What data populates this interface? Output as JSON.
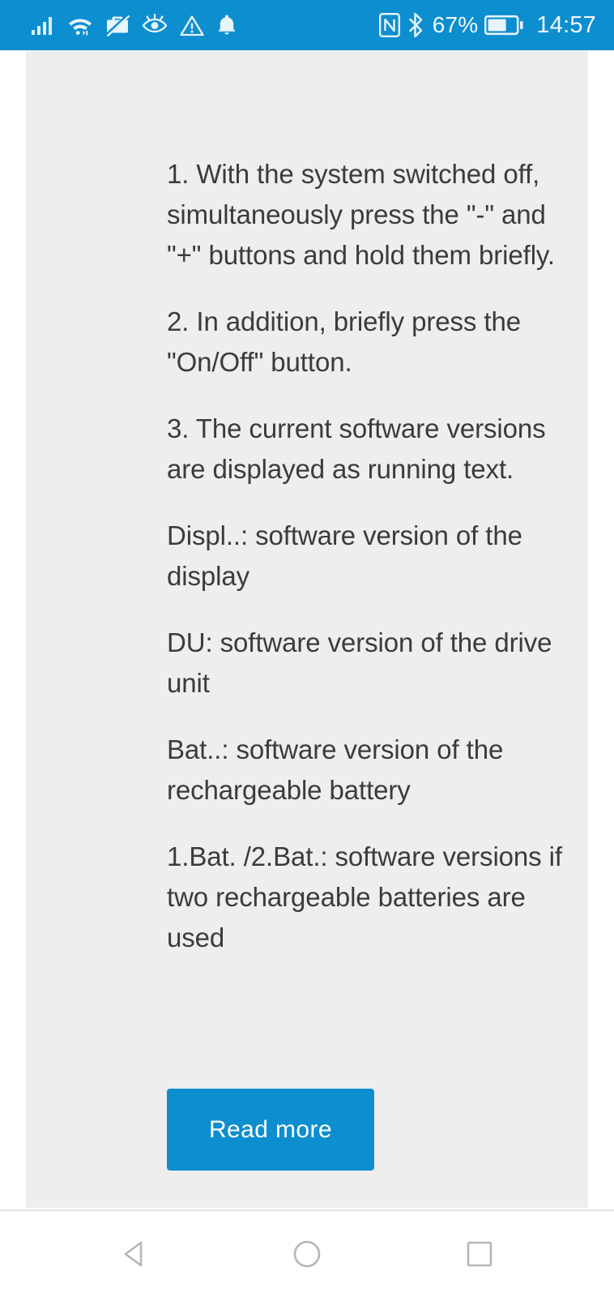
{
  "statusbar": {
    "background_color": "#0d8ecf",
    "left_icons": [
      {
        "name": "signal-bars-icon",
        "label": "cellular signal"
      },
      {
        "name": "wifi-icon",
        "label": "wifi"
      },
      {
        "name": "work-profile-off-icon",
        "label": "work profile disabled"
      },
      {
        "name": "eye-comfort-icon",
        "label": "eye comfort mode"
      },
      {
        "name": "warning-triangle-icon",
        "label": "warning"
      },
      {
        "name": "notification-bell-icon",
        "label": "notification"
      }
    ],
    "right_icons": [
      {
        "name": "nfc-icon",
        "label": "NFC"
      },
      {
        "name": "bluetooth-icon",
        "label": "Bluetooth"
      },
      {
        "name": "battery-icon",
        "label": "battery"
      }
    ],
    "battery_percent": "67%",
    "clock": "14:57"
  },
  "content": {
    "background_color": "#eeeeee",
    "text_color": "#3b3b3b",
    "paragraphs": [
      "1. With the system switched off, simultaneously press the \"-\" and \"+\" buttons and hold them briefly.",
      "2. In addition, briefly press the \"On/Off\" button.",
      "3. The current software versions are displayed as running text.",
      "Displ..: software version of the display",
      "DU: software version of the drive unit",
      "Bat..: software version of the rechargeable battery",
      "1.Bat. /2.Bat.: software versions if two rechargeable batteries are used"
    ]
  },
  "actions": {
    "read_more_label": "Read more",
    "read_more_color": "#0d8ecf"
  },
  "navbar": {
    "buttons": [
      {
        "name": "nav-back-button",
        "label": "Back"
      },
      {
        "name": "nav-home-button",
        "label": "Home"
      },
      {
        "name": "nav-recents-button",
        "label": "Recents"
      }
    ]
  }
}
